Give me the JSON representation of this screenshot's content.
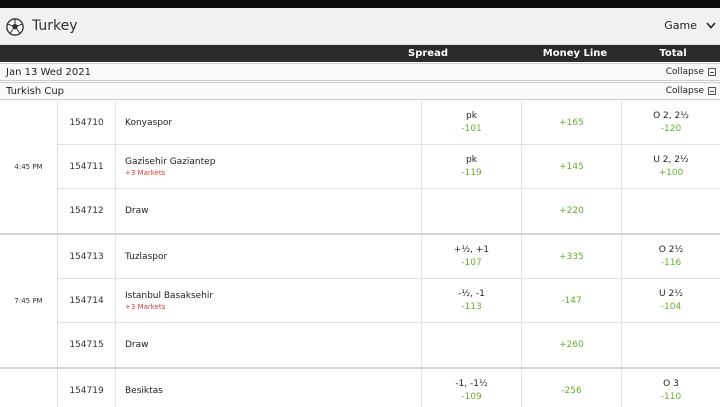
{
  "header": {
    "title": "Turkey",
    "game_select": "Game"
  },
  "columns": {
    "spread": "Spread",
    "moneyline": "Money Line",
    "total": "Total"
  },
  "date_bar": {
    "label": "Jan 13 Wed 2021",
    "collapse": "Collapse"
  },
  "competition_bar": {
    "label": "Turkish Cup",
    "collapse": "Collapse"
  },
  "games": [
    {
      "time": "4:45 PM",
      "rows": [
        {
          "rot": "154710",
          "team": "Konyaspor",
          "markets": "",
          "spread_line": "pk",
          "spread_price": "-101",
          "moneyline": "+165",
          "total_line": "O 2, 2½",
          "total_price": "-120"
        },
        {
          "rot": "154711",
          "team": "Gazisehir Gaziantep",
          "markets": "+3 Markets",
          "spread_line": "pk",
          "spread_price": "-119",
          "moneyline": "+145",
          "total_line": "U 2, 2½",
          "total_price": "+100"
        },
        {
          "rot": "154712",
          "team": "Draw",
          "markets": "",
          "spread_line": "",
          "spread_price": "",
          "moneyline": "+220",
          "total_line": "",
          "total_price": ""
        }
      ]
    },
    {
      "time": "7:45 PM",
      "rows": [
        {
          "rot": "154713",
          "team": "Tuzlaspor",
          "markets": "",
          "spread_line": "+½, +1",
          "spread_price": "-107",
          "moneyline": "+335",
          "total_line": "O 2½",
          "total_price": "-116"
        },
        {
          "rot": "154714",
          "team": "Istanbul Basaksehir",
          "markets": "+3 Markets",
          "spread_line": "-½, -1",
          "spread_price": "-113",
          "moneyline": "-147",
          "total_line": "U 2½",
          "total_price": "-104"
        },
        {
          "rot": "154715",
          "team": "Draw",
          "markets": "",
          "spread_line": "",
          "spread_price": "",
          "moneyline": "+260",
          "total_line": "",
          "total_price": ""
        }
      ]
    },
    {
      "time": "",
      "rows": [
        {
          "rot": "154719",
          "team": "Besiktas",
          "markets": "",
          "spread_line": "-1, -1½",
          "spread_price": "-109",
          "moneyline": "-256",
          "total_line": "O 3",
          "total_price": "-110"
        }
      ]
    }
  ],
  "colors": {
    "price_green": "#6aae2f",
    "markets_red": "#d23b3b",
    "header_dark": "#2b2b2b"
  }
}
